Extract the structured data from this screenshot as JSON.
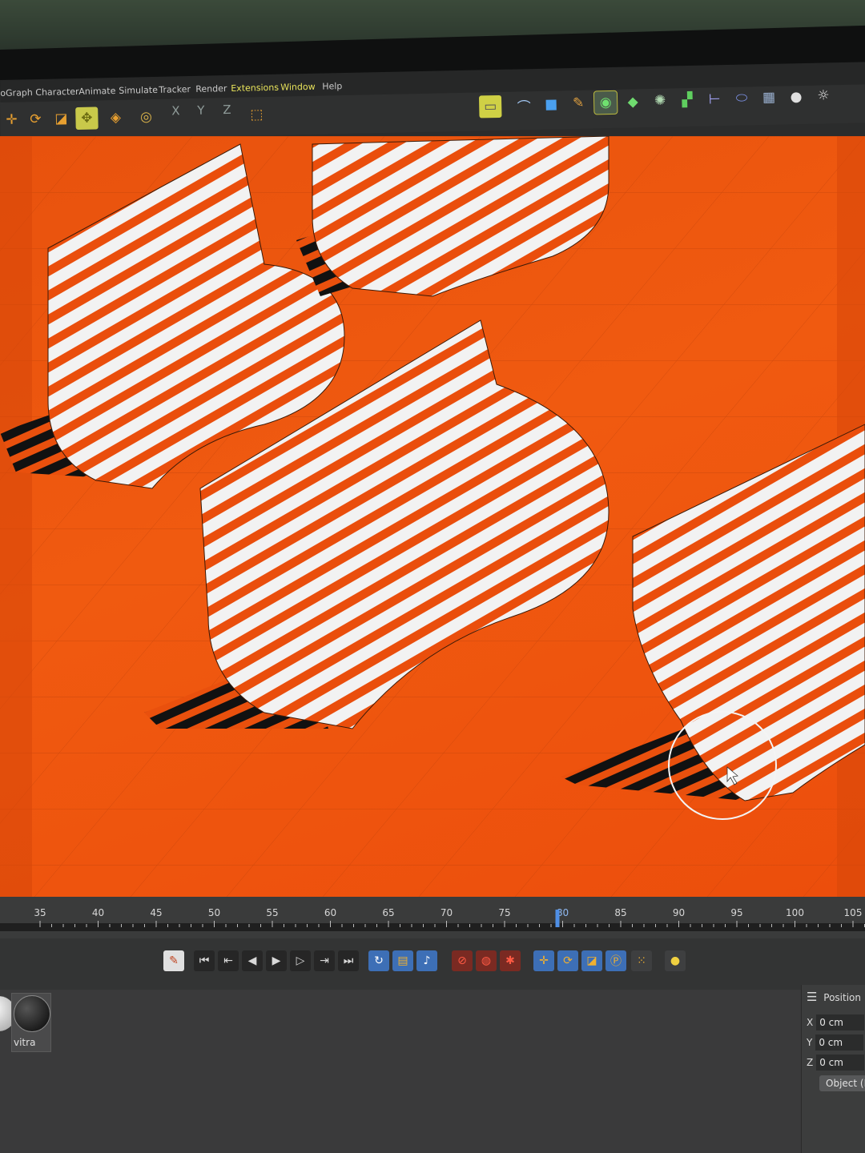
{
  "menubar": {
    "items": [
      {
        "label": "oGraph",
        "highlight": false
      },
      {
        "label": "Character",
        "highlight": false
      },
      {
        "label": "Animate",
        "highlight": false
      },
      {
        "label": "Simulate",
        "highlight": false
      },
      {
        "label": "Tracker",
        "highlight": false
      },
      {
        "label": "Render",
        "highlight": false
      },
      {
        "label": "Extensions",
        "highlight": true
      },
      {
        "label": "Window",
        "highlight": true
      },
      {
        "label": "Help",
        "highlight": false
      }
    ]
  },
  "toolbar": {
    "axes": {
      "x": "X",
      "y": "Y",
      "z": "Z"
    },
    "icons": [
      "move-icon",
      "rotate-icon",
      "scale-icon",
      "live-select-icon",
      "transform-icon",
      "snap-icon",
      "coordinate-system-icon",
      "render-region-icon",
      "spline-pen-icon",
      "cube-icon",
      "sketch-icon",
      "selected-object-icon",
      "generator-icon",
      "cloner-icon",
      "mograph-cubes-icon",
      "deformer-icon",
      "field-icon",
      "floor-icon",
      "camera-icon",
      "light-icon"
    ]
  },
  "viewport": {
    "background_color": "#ee550e",
    "stripe_color": "#f2f2f2",
    "shadow_color": "#101010"
  },
  "timeline": {
    "ticks": [
      "35",
      "40",
      "45",
      "50",
      "55",
      "60",
      "65",
      "70",
      "75",
      "80",
      "85",
      "90",
      "95",
      "100",
      "105"
    ],
    "current_frame": "80",
    "playhead_color": "#4f8fe6"
  },
  "transport": {
    "icons": [
      "record-key-icon",
      "go-to-start-icon",
      "previous-key-icon",
      "previous-frame-icon",
      "play-icon",
      "next-frame-icon",
      "next-key-icon",
      "go-to-end-icon",
      "loop-icon",
      "film-icon",
      "sound-icon",
      "record-active-icon",
      "auto-key-icon",
      "keyframe-selection-icon",
      "key-position-icon",
      "key-rotation-icon",
      "key-scale-icon",
      "key-param-icon",
      "key-pla-icon",
      "motion-system-icon"
    ]
  },
  "material": {
    "name": "vitra"
  },
  "attributes": {
    "title": "Position",
    "rows": [
      {
        "axis": "X",
        "value": "0 cm"
      },
      {
        "axis": "Y",
        "value": "0 cm"
      },
      {
        "axis": "Z",
        "value": "0 cm"
      }
    ],
    "object_button": "Object (R"
  }
}
